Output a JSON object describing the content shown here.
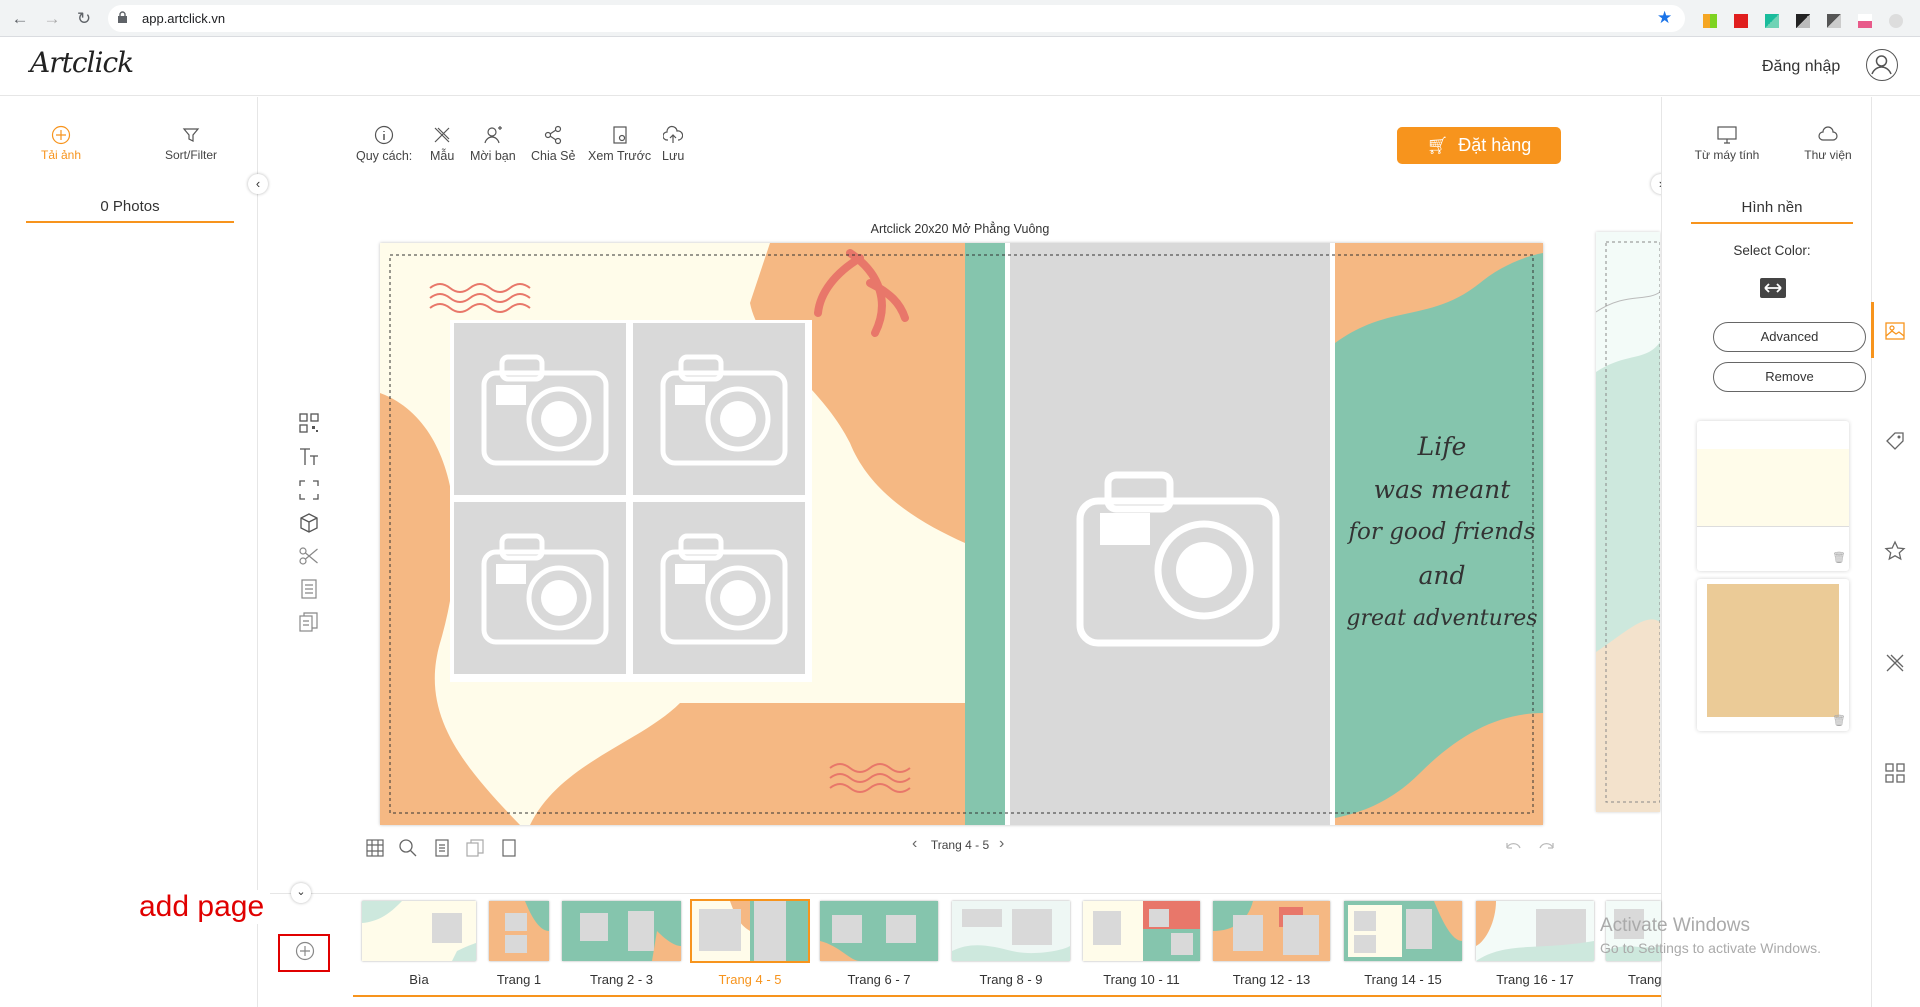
{
  "browser": {
    "url": "app.artclick.vn"
  },
  "header": {
    "logo": "Artclick",
    "login": "Đăng nhập"
  },
  "left_panel": {
    "tabs": [
      {
        "label": "Tải ảnh",
        "active": true
      },
      {
        "label": "Sort/Filter",
        "active": false
      }
    ],
    "photos_count": "0 Photos"
  },
  "toolbar": {
    "items": [
      {
        "label": "Quy cách:",
        "icon": "info-icon"
      },
      {
        "label": "Mẫu",
        "icon": "template-icon"
      },
      {
        "label": "Mời bạn",
        "icon": "invite-icon"
      },
      {
        "label": "Chia Sẻ",
        "icon": "share-icon"
      },
      {
        "label": "Xem Trước",
        "icon": "preview-icon"
      },
      {
        "label": "Lưu",
        "icon": "save-icon"
      }
    ],
    "order_button": "Đặt hàng"
  },
  "editor": {
    "book_title": "Artclick   20x20 Mở Phẳng Vuông",
    "quote_lines": [
      "Life",
      "was meant",
      "for good friends",
      "and",
      "great adventures"
    ],
    "pager": "Trang 4 - 5"
  },
  "right_panel": {
    "tabs": [
      {
        "label": "Từ máy tính",
        "icon": "monitor-icon"
      },
      {
        "label": "Thư viện",
        "icon": "cloud-icon"
      }
    ],
    "section_title": "Hình nền",
    "select_color": "Select Color:",
    "advanced": "Advanced",
    "remove": "Remove",
    "swatches": [
      "#fffcea",
      "#ebcb97"
    ]
  },
  "thumbnails": [
    {
      "label": "Bìa",
      "active": false
    },
    {
      "label": "Trang 1",
      "active": false
    },
    {
      "label": "Trang 2 - 3",
      "active": false
    },
    {
      "label": "Trang 4 - 5",
      "active": true
    },
    {
      "label": "Trang 6 - 7",
      "active": false
    },
    {
      "label": "Trang 8 - 9",
      "active": false
    },
    {
      "label": "Trang 10 - 11",
      "active": false
    },
    {
      "label": "Trang 12 - 13",
      "active": false
    },
    {
      "label": "Trang 14 - 15",
      "active": false
    },
    {
      "label": "Trang 16 - 17",
      "active": false
    },
    {
      "label": "Trang",
      "active": false
    }
  ],
  "annotation": {
    "add_page": "add page"
  },
  "watermark": {
    "line1": "Activate Windows",
    "line2": "Go to Settings to activate Windows."
  },
  "colors": {
    "accent": "#f7941d",
    "teal": "#85c5ad",
    "peach": "#f5b883",
    "annotation_red": "#e00000"
  }
}
